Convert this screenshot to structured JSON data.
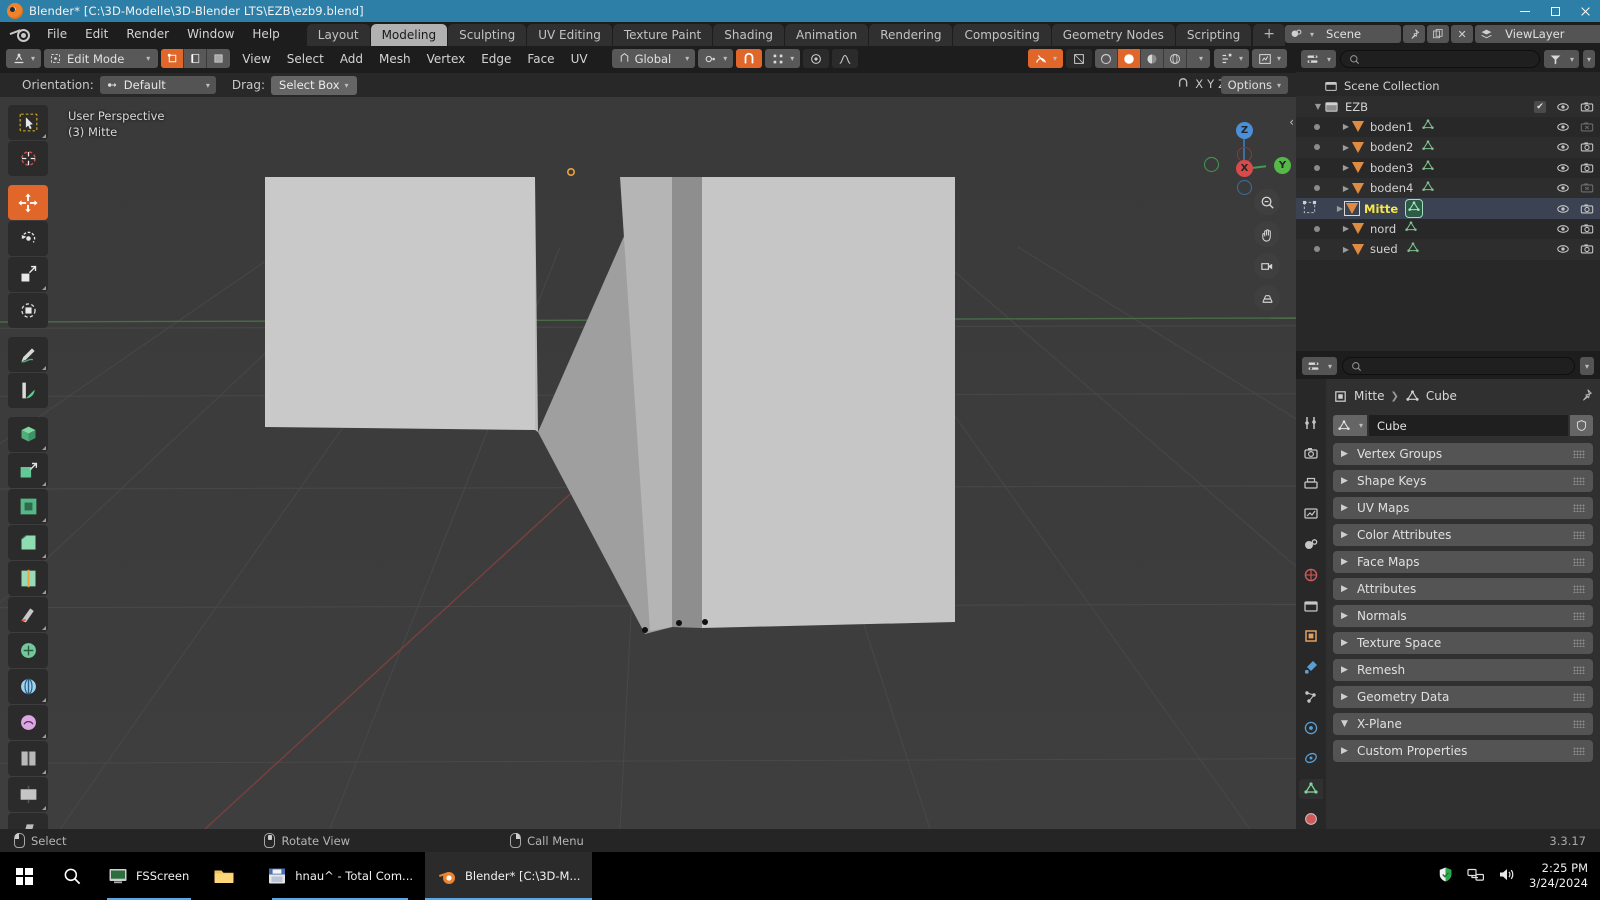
{
  "window": {
    "title": "Blender* [C:\\3D-Modelle\\3D-Blender LTS\\EZB\\ezb9.blend]",
    "app_icon": "blender-icon",
    "minimize": "minimize-icon",
    "maximize": "maximize-icon",
    "close": "close-icon"
  },
  "topbar": {
    "logo": "blender-logo-icon",
    "menus": [
      "File",
      "Edit",
      "Render",
      "Window",
      "Help"
    ],
    "workspaces": [
      {
        "label": "Layout",
        "active": false
      },
      {
        "label": "Modeling",
        "active": true
      },
      {
        "label": "Sculpting",
        "active": false
      },
      {
        "label": "UV Editing",
        "active": false
      },
      {
        "label": "Texture Paint",
        "active": false
      },
      {
        "label": "Shading",
        "active": false
      },
      {
        "label": "Animation",
        "active": false
      },
      {
        "label": "Rendering",
        "active": false
      },
      {
        "label": "Compositing",
        "active": false
      },
      {
        "label": "Geometry Nodes",
        "active": false
      },
      {
        "label": "Scripting",
        "active": false
      }
    ],
    "add_workspace": "+",
    "scene_name": "Scene",
    "viewlayer_name": "ViewLayer",
    "scene_icon": "scene-icon",
    "pin_icon": "pin-icon",
    "copy_icon": "duplicate-icon",
    "delete_icon": "x-icon",
    "viewlayer_icon": "viewlayer-icon"
  },
  "viewport_header": {
    "editor_type_icon": "editor-type-icon",
    "mode": "Edit Mode",
    "select_modes": [
      "vertex-select-icon",
      "edge-select-icon",
      "face-select-icon"
    ],
    "active_select_mode": 0,
    "menus": [
      "View",
      "Select",
      "Add",
      "Mesh",
      "Vertex",
      "Edge",
      "Face",
      "UV"
    ],
    "transform_orientation": "Global",
    "orientation_icon": "orientation-icon",
    "pivot_icon": "pivot-point-icon",
    "snap_icon": "snap-magnet-icon",
    "snap_to_icon": "snap-increment-icon",
    "proportional_icon": "proportional-editing-icon",
    "falloff_icon": "proportional-falloff-icon",
    "xray_icon": "toggle-xray-icon",
    "shading_modes": [
      "wireframe-icon",
      "solid-icon",
      "material-preview-icon",
      "rendered-icon"
    ],
    "active_shading": 1,
    "visibility_icon": "object-visibility-icon",
    "gizmo_icon": "show-gizmo-icon",
    "overlays_icon": "show-overlays-icon"
  },
  "tool_settings": {
    "orientation_label": "Orientation:",
    "orientation_value": "Default",
    "drag_label": "Drag:",
    "drag_value": "Select Box",
    "options_label": "Options",
    "axis_locks": [
      "X",
      "Y",
      "Z"
    ],
    "snap_label": "snap-during-transform-icon"
  },
  "viewport": {
    "perspective_text": "User Perspective",
    "object_text": "(3) Mitte",
    "tools": [
      {
        "name": "tweak-select-tool",
        "active": false
      },
      {
        "name": "cursor-tool",
        "active": false
      },
      {
        "name": "move-tool",
        "active": true
      },
      {
        "name": "rotate-tool",
        "active": false
      },
      {
        "name": "scale-tool",
        "active": false
      },
      {
        "name": "transform-tool",
        "active": false
      },
      {
        "name": "annotate-tool",
        "active": false
      },
      {
        "name": "measure-tool",
        "active": false
      },
      {
        "name": "add-cube-tool",
        "active": false
      },
      {
        "name": "extrude-region-tool",
        "active": false
      },
      {
        "name": "inset-faces-tool",
        "active": false
      },
      {
        "name": "bevel-tool",
        "active": false
      },
      {
        "name": "loop-cut-tool",
        "active": false
      },
      {
        "name": "knife-tool",
        "active": false
      },
      {
        "name": "poly-build-tool",
        "active": false
      },
      {
        "name": "spin-tool",
        "active": false
      },
      {
        "name": "smooth-tool",
        "active": false
      },
      {
        "name": "edge-slide-tool",
        "active": false
      },
      {
        "name": "shrink-fatten-tool",
        "active": false
      },
      {
        "name": "shear-tool",
        "active": false
      },
      {
        "name": "rip-region-tool",
        "active": false
      }
    ],
    "gizmo_axes": [
      {
        "label": "Z",
        "color": "#4a90d9"
      },
      {
        "label": "X",
        "color": "#d94a4a"
      },
      {
        "label": "Y",
        "color": "#57b84a"
      }
    ],
    "nav_buttons": [
      "zoom-icon",
      "pan-hand-icon",
      "camera-view-icon",
      "toggle-perspective-icon"
    ]
  },
  "outliner": {
    "display_mode_icon": "outliner-display-mode-icon",
    "filter_icon": "filter-icon",
    "search_placeholder": "",
    "search_icon": "search-icon",
    "root": "Scene Collection",
    "collection": {
      "name": "EZB",
      "icon": "collection-icon",
      "checkbox": true,
      "eye": "eye-icon",
      "camera": "camera-icon"
    },
    "objects": [
      {
        "name": "boden1",
        "active": false,
        "eye": true,
        "camera": false
      },
      {
        "name": "boden2",
        "active": false,
        "eye": true,
        "camera": true
      },
      {
        "name": "boden3",
        "active": false,
        "eye": true,
        "camera": true
      },
      {
        "name": "boden4",
        "active": false,
        "eye": true,
        "camera": false
      },
      {
        "name": "Mitte",
        "active": true,
        "eye": true,
        "camera": true
      },
      {
        "name": "nord",
        "active": false,
        "eye": true,
        "camera": true
      },
      {
        "name": "sued",
        "active": false,
        "eye": true,
        "camera": true
      }
    ]
  },
  "properties": {
    "editor_icon": "properties-editor-icon",
    "search_placeholder": "",
    "breadcrumb": {
      "object": "Mitte",
      "data": "Cube"
    },
    "data_name": "Cube",
    "data_icon": "mesh-data-icon",
    "shield_icon": "fake-user-icon",
    "pin_icon": "pin-icon",
    "tabs": [
      {
        "name": "tool-tab",
        "active": false
      },
      {
        "name": "render-tab",
        "active": false
      },
      {
        "name": "output-tab",
        "active": false
      },
      {
        "name": "view-layer-tab",
        "active": false
      },
      {
        "name": "scene-tab",
        "active": false
      },
      {
        "name": "world-tab",
        "active": false
      },
      {
        "name": "collection-tab",
        "active": false
      },
      {
        "name": "object-tab",
        "active": false
      },
      {
        "name": "modifier-tab",
        "active": false
      },
      {
        "name": "particles-tab",
        "active": false
      },
      {
        "name": "physics-tab",
        "active": false
      },
      {
        "name": "constraints-tab",
        "active": false
      },
      {
        "name": "object-data-tab",
        "active": true
      },
      {
        "name": "material-tab",
        "active": false
      }
    ],
    "panels": [
      {
        "label": "Vertex Groups",
        "expanded": false
      },
      {
        "label": "Shape Keys",
        "expanded": false
      },
      {
        "label": "UV Maps",
        "expanded": false
      },
      {
        "label": "Color Attributes",
        "expanded": false
      },
      {
        "label": "Face Maps",
        "expanded": false
      },
      {
        "label": "Attributes",
        "expanded": false
      },
      {
        "label": "Normals",
        "expanded": false
      },
      {
        "label": "Texture Space",
        "expanded": false
      },
      {
        "label": "Remesh",
        "expanded": false
      },
      {
        "label": "Geometry Data",
        "expanded": false
      },
      {
        "label": "X-Plane",
        "expanded": true
      },
      {
        "label": "Custom Properties",
        "expanded": false
      }
    ]
  },
  "statusbar": {
    "hints": [
      {
        "icon": "mouse-left-icon",
        "label": "Select"
      },
      {
        "icon": "mouse-middle-icon",
        "label": "Rotate View"
      },
      {
        "icon": "mouse-right-icon",
        "label": "Call Menu"
      }
    ],
    "version": "3.3.17"
  },
  "taskbar": {
    "start_icon": "windows-start-icon",
    "search_icon": "search-icon",
    "apps": [
      {
        "label": "FSScreen",
        "icon": "fsscreen-icon",
        "active": false,
        "running": true
      },
      {
        "label": "",
        "icon": "file-explorer-icon",
        "active": false,
        "running": false
      },
      {
        "label": "hnau^ - Total Com...",
        "icon": "total-commander-icon",
        "active": false,
        "running": true
      },
      {
        "label": "Blender* [C:\\3D-M...",
        "icon": "blender-icon",
        "active": true,
        "running": true
      }
    ],
    "tray": [
      "defender-shield-icon",
      "network-icon",
      "volume-icon"
    ],
    "time": "2:25 PM",
    "date": "3/24/2024"
  }
}
